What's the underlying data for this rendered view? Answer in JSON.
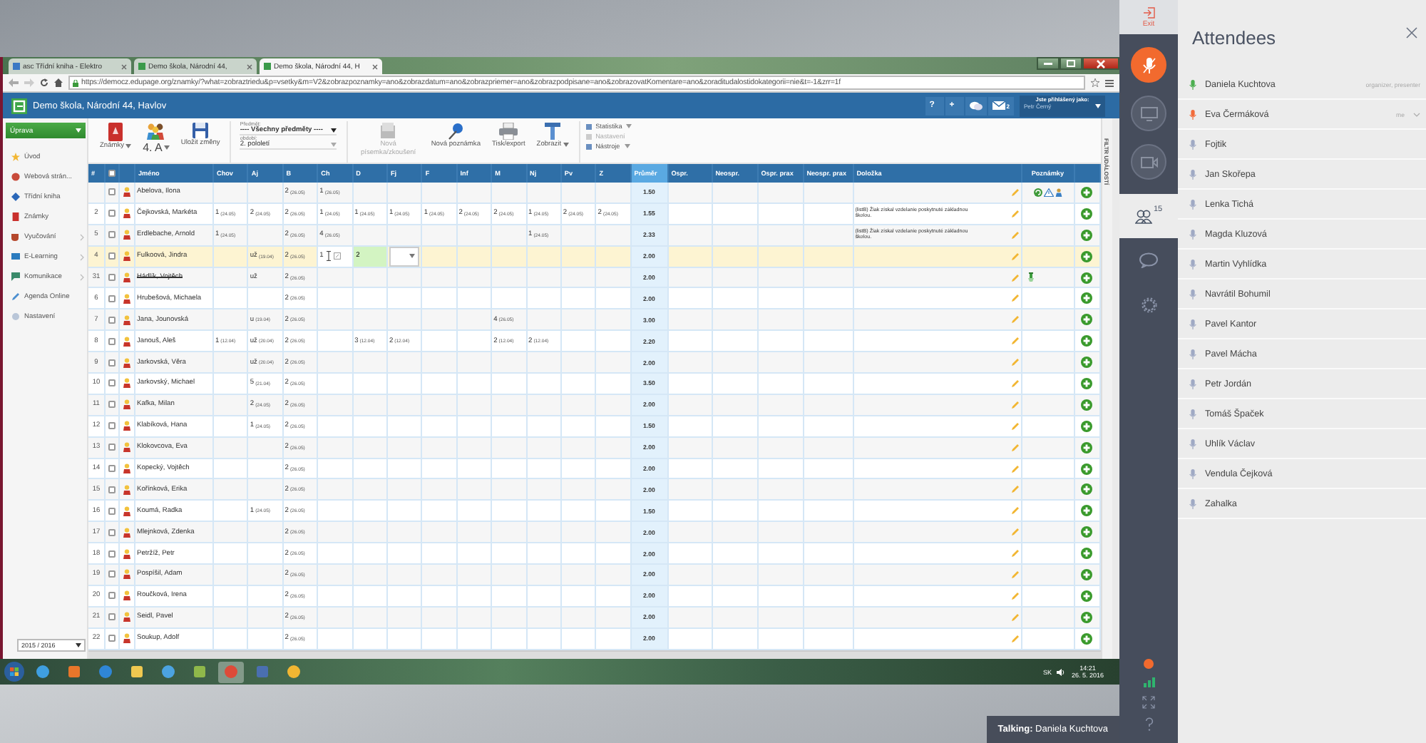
{
  "browser": {
    "tabs": [
      {
        "title": "asc Třídní kniha - Elektro",
        "selected": false
      },
      {
        "title": "Demo škola, Národní 44,",
        "selected": false
      },
      {
        "title": "Demo škola, Národní 44, H",
        "selected": true
      }
    ],
    "url": "https://democz.edupage.org/znamky/?what=zobraztriedu&p=vsetky&m=V2&zobrazpoznamky=ano&zobrazdatum=ano&zobrazpriemer=ano&zobrazpodpisane=ano&zobrazovatKomentare=ano&zoraditudalostidokategorii=nie&t=-1&zrr=1f"
  },
  "site": {
    "title": "Demo škola, Národní 44, Havlov",
    "header_buttons": [
      "?",
      "+"
    ],
    "mail_count": "2",
    "user_label": "Jste přihlášený jako:",
    "user_name": "Petr Černý"
  },
  "sidebar": {
    "action": "Úprava",
    "items": [
      {
        "label": "Úvod",
        "submenu": false
      },
      {
        "label": "Webová strán...",
        "submenu": false
      },
      {
        "label": "Třídní kniha",
        "submenu": false
      },
      {
        "label": "Známky",
        "submenu": false
      },
      {
        "label": "Vyučování",
        "submenu": true
      },
      {
        "label": "E-Learning",
        "submenu": true
      },
      {
        "label": "Komunikace",
        "submenu": true
      },
      {
        "label": "Agenda Online",
        "submenu": false
      },
      {
        "label": "Nastavení",
        "submenu": false
      }
    ],
    "year": "2015 / 2016"
  },
  "toolbar": {
    "buttons": [
      {
        "label": "Známky",
        "kind": "icon",
        "dropdown": true
      },
      {
        "label": "4. A",
        "kind": "class",
        "dropdown": true
      },
      {
        "label": "Uložit změny",
        "kind": "icon",
        "dropdown": false
      }
    ],
    "picker": {
      "label": "Předmět:",
      "value": "---- Všechny předměty ----",
      "period_label": "období:",
      "period_value": "2. pololetí"
    },
    "actions": [
      {
        "label": "Nová písemka/zkoušení",
        "disabled": true,
        "dropdown": false
      },
      {
        "label": "Nová poznámka",
        "disabled": false,
        "dropdown": false
      },
      {
        "label": "Tisk/export",
        "disabled": false,
        "dropdown": false
      },
      {
        "label": "Zobrazit",
        "disabled": false,
        "dropdown": true
      }
    ],
    "menu": [
      {
        "label": "Statistika",
        "disabled": false,
        "dropdown": true
      },
      {
        "label": "Nastavení",
        "disabled": true,
        "dropdown": false
      },
      {
        "label": "Nástroje",
        "disabled": false,
        "dropdown": true
      }
    ]
  },
  "table": {
    "number_header": "#",
    "all_checked": false,
    "name_header": "Jméno",
    "subjects": [
      "Chov",
      "Aj",
      "B",
      "Ch",
      "D",
      "Fj",
      "F",
      "Inf",
      "M",
      "Nj",
      "Pv",
      "Z"
    ],
    "average_header": "Průměr",
    "absence_headers": [
      "Ospr.",
      "Neospr.",
      "Ospr. prax",
      "Neospr. prax"
    ],
    "clause_header": "Doložka",
    "notes_header": "Poznámky",
    "rows": [
      {
        "name": "Abelova, Ilona",
        "checked": false,
        "selected": false,
        "withdrawn": false,
        "grades": [
          {
            "kind": "empty"
          },
          {
            "kind": "empty"
          },
          {
            "kind": "grade",
            "grade": "2",
            "date": "(26.05)"
          },
          {
            "kind": "grade",
            "grade": "1",
            "date": "(26.05)"
          },
          {
            "kind": "empty"
          },
          {
            "kind": "empty"
          },
          {
            "kind": "empty"
          },
          {
            "kind": "empty"
          },
          {
            "kind": "empty"
          },
          {
            "kind": "empty"
          },
          {
            "kind": "empty"
          },
          {
            "kind": "empty"
          }
        ],
        "average": "1.50",
        "note": {
          "kind": "alerts"
        }
      },
      {
        "number": "2",
        "name": "Čejkovská, Markéta",
        "checked": false,
        "selected": false,
        "withdrawn": false,
        "grades": [
          {
            "kind": "grade",
            "grade": "1",
            "date": "(24.05)"
          },
          {
            "kind": "grade",
            "grade": "2",
            "date": "(24.05)"
          },
          {
            "kind": "grade",
            "grade": "2",
            "date": "(26.05)"
          },
          {
            "kind": "grade",
            "grade": "1",
            "date": "(24.05)"
          },
          {
            "kind": "grade",
            "grade": "1",
            "date": "(24.05)"
          },
          {
            "kind": "grade",
            "grade": "1",
            "date": "(24.05)"
          },
          {
            "kind": "grade",
            "grade": "1",
            "date": "(24.05)"
          },
          {
            "kind": "grade",
            "grade": "2",
            "date": "(24.05)"
          },
          {
            "kind": "grade",
            "grade": "2",
            "date": "(24.05)"
          },
          {
            "kind": "grade",
            "grade": "1",
            "date": "(24.05)"
          },
          {
            "kind": "grade",
            "grade": "2",
            "date": "(24.05)"
          },
          {
            "kind": "grade",
            "grade": "2",
            "date": "(24.05)"
          }
        ],
        "average": "1.55",
        "clause": "(listB) Žiak získal vzdelanie poskytnuté základnou školou."
      },
      {
        "number": "5",
        "name": "Erdlebache, Arnold",
        "checked": false,
        "selected": false,
        "withdrawn": false,
        "grades": [
          {
            "kind": "grade",
            "grade": "1",
            "date": "(24.05)"
          },
          {
            "kind": "empty"
          },
          {
            "kind": "grade",
            "grade": "2",
            "date": "(26.05)"
          },
          {
            "kind": "grade",
            "grade": "4",
            "date": "(26.05)"
          },
          {
            "kind": "empty"
          },
          {
            "kind": "empty"
          },
          {
            "kind": "empty"
          },
          {
            "kind": "empty"
          },
          {
            "kind": "empty"
          },
          {
            "kind": "grade",
            "grade": "1",
            "date": "(24.05)"
          },
          {
            "kind": "empty"
          },
          {
            "kind": "empty"
          }
        ],
        "average": "2.33",
        "clause": "(listB) Žiak získal vzdelanie poskytnuté základnou školou."
      },
      {
        "number": "4",
        "name": "Fulkoová, Jindra",
        "checked": false,
        "selected": true,
        "withdrawn": false,
        "grades": [
          {
            "kind": "empty"
          },
          {
            "kind": "grade",
            "grade": "už",
            "date": "(19.04)"
          },
          {
            "kind": "grade",
            "grade": "2",
            "date": "(26.05)"
          },
          {
            "kind": "cursor",
            "grade": "1"
          },
          {
            "kind": "editing",
            "grade": "2"
          },
          {
            "kind": "select"
          },
          {
            "kind": "empty"
          },
          {
            "kind": "empty"
          },
          {
            "kind": "empty"
          },
          {
            "kind": "empty"
          },
          {
            "kind": "empty"
          },
          {
            "kind": "empty"
          }
        ],
        "average": "2.00"
      },
      {
        "number": "31",
        "name": "Hádlík, Vojtěch",
        "checked": false,
        "selected": false,
        "withdrawn": true,
        "grades": [
          {
            "kind": "empty"
          },
          {
            "kind": "grade",
            "grade": "už"
          },
          {
            "kind": "grade",
            "grade": "2",
            "date": "(26.05)"
          },
          {
            "kind": "empty"
          },
          {
            "kind": "empty"
          },
          {
            "kind": "empty"
          },
          {
            "kind": "empty"
          },
          {
            "kind": "empty"
          },
          {
            "kind": "empty"
          },
          {
            "kind": "empty"
          },
          {
            "kind": "empty"
          },
          {
            "kind": "empty"
          }
        ],
        "average": "2.00",
        "note": {
          "kind": "pin"
        }
      },
      {
        "number": "6",
        "name": "Hrubešová, Michaela",
        "checked": false,
        "selected": false,
        "withdrawn": false,
        "grades": [
          {
            "kind": "empty"
          },
          {
            "kind": "empty"
          },
          {
            "kind": "grade",
            "grade": "2",
            "date": "(26.05)"
          },
          {
            "kind": "empty"
          },
          {
            "kind": "empty"
          },
          {
            "kind": "empty"
          },
          {
            "kind": "empty"
          },
          {
            "kind": "empty"
          },
          {
            "kind": "empty"
          },
          {
            "kind": "empty"
          },
          {
            "kind": "empty"
          },
          {
            "kind": "empty"
          }
        ],
        "average": "2.00"
      },
      {
        "number": "7",
        "name": "Jana, Jounovská",
        "checked": false,
        "selected": false,
        "withdrawn": false,
        "grades": [
          {
            "kind": "empty"
          },
          {
            "kind": "grade",
            "grade": "u",
            "date": "(19.04)"
          },
          {
            "kind": "grade",
            "grade": "2",
            "date": "(26.05)"
          },
          {
            "kind": "empty"
          },
          {
            "kind": "empty"
          },
          {
            "kind": "empty"
          },
          {
            "kind": "empty"
          },
          {
            "kind": "empty"
          },
          {
            "kind": "grade",
            "grade": "4",
            "date": "(26.05)"
          },
          {
            "kind": "empty"
          },
          {
            "kind": "empty"
          },
          {
            "kind": "empty"
          }
        ],
        "average": "3.00"
      },
      {
        "number": "8",
        "name": "Janouš, Aleš",
        "checked": false,
        "selected": false,
        "withdrawn": false,
        "grades": [
          {
            "kind": "grade",
            "grade": "1",
            "date": "(12.04)"
          },
          {
            "kind": "grade",
            "grade": "už",
            "date": "(20.04)"
          },
          {
            "kind": "grade",
            "grade": "2",
            "date": "(26.05)"
          },
          {
            "kind": "empty"
          },
          {
            "kind": "grade",
            "grade": "3",
            "date": "(12.04)"
          },
          {
            "kind": "grade",
            "grade": "2",
            "date": "(12.04)"
          },
          {
            "kind": "empty"
          },
          {
            "kind": "empty"
          },
          {
            "kind": "grade",
            "grade": "2",
            "date": "(12.04)"
          },
          {
            "kind": "grade",
            "grade": "2",
            "date": "(12.04)"
          },
          {
            "kind": "empty"
          },
          {
            "kind": "empty"
          }
        ],
        "average": "2.20"
      },
      {
        "number": "9",
        "name": "Jarkovská, Věra",
        "checked": false,
        "selected": false,
        "withdrawn": false,
        "grades": [
          {
            "kind": "empty"
          },
          {
            "kind": "grade",
            "grade": "už",
            "date": "(20.04)"
          },
          {
            "kind": "grade",
            "grade": "2",
            "date": "(26.05)"
          },
          {
            "kind": "empty"
          },
          {
            "kind": "empty"
          },
          {
            "kind": "empty"
          },
          {
            "kind": "empty"
          },
          {
            "kind": "empty"
          },
          {
            "kind": "empty"
          },
          {
            "kind": "empty"
          },
          {
            "kind": "empty"
          },
          {
            "kind": "empty"
          }
        ],
        "average": "2.00"
      },
      {
        "number": "10",
        "name": "Jarkovský, Michael",
        "checked": false,
        "selected": false,
        "withdrawn": false,
        "grades": [
          {
            "kind": "empty"
          },
          {
            "kind": "grade",
            "grade": "5",
            "date": "(21.04)"
          },
          {
            "kind": "grade",
            "grade": "2",
            "date": "(26.05)"
          },
          {
            "kind": "empty"
          },
          {
            "kind": "empty"
          },
          {
            "kind": "empty"
          },
          {
            "kind": "empty"
          },
          {
            "kind": "empty"
          },
          {
            "kind": "empty"
          },
          {
            "kind": "empty"
          },
          {
            "kind": "empty"
          },
          {
            "kind": "empty"
          }
        ],
        "average": "3.50"
      },
      {
        "number": "11",
        "name": "Kafka, Milan",
        "checked": false,
        "selected": false,
        "withdrawn": false,
        "grades": [
          {
            "kind": "empty"
          },
          {
            "kind": "grade",
            "grade": "2",
            "date": "(24.05)"
          },
          {
            "kind": "grade",
            "grade": "2",
            "date": "(26.05)"
          },
          {
            "kind": "empty"
          },
          {
            "kind": "empty"
          },
          {
            "kind": "empty"
          },
          {
            "kind": "empty"
          },
          {
            "kind": "empty"
          },
          {
            "kind": "empty"
          },
          {
            "kind": "empty"
          },
          {
            "kind": "empty"
          },
          {
            "kind": "empty"
          }
        ],
        "average": "2.00"
      },
      {
        "number": "12",
        "name": "Klabíková, Hana",
        "checked": false,
        "selected": false,
        "withdrawn": false,
        "grades": [
          {
            "kind": "empty"
          },
          {
            "kind": "grade",
            "grade": "1",
            "date": "(24.05)"
          },
          {
            "kind": "grade",
            "grade": "2",
            "date": "(26.05)"
          },
          {
            "kind": "empty"
          },
          {
            "kind": "empty"
          },
          {
            "kind": "empty"
          },
          {
            "kind": "empty"
          },
          {
            "kind": "empty"
          },
          {
            "kind": "empty"
          },
          {
            "kind": "empty"
          },
          {
            "kind": "empty"
          },
          {
            "kind": "empty"
          }
        ],
        "average": "1.50"
      },
      {
        "number": "13",
        "name": "Klokovcova, Eva",
        "checked": false,
        "selected": false,
        "withdrawn": false,
        "grades": [
          {
            "kind": "empty"
          },
          {
            "kind": "empty"
          },
          {
            "kind": "grade",
            "grade": "2",
            "date": "(26.05)"
          },
          {
            "kind": "empty"
          },
          {
            "kind": "empty"
          },
          {
            "kind": "empty"
          },
          {
            "kind": "empty"
          },
          {
            "kind": "empty"
          },
          {
            "kind": "empty"
          },
          {
            "kind": "empty"
          },
          {
            "kind": "empty"
          },
          {
            "kind": "empty"
          }
        ],
        "average": "2.00"
      },
      {
        "number": "14",
        "name": "Kopecký, Vojtěch",
        "checked": false,
        "selected": false,
        "withdrawn": false,
        "grades": [
          {
            "kind": "empty"
          },
          {
            "kind": "empty"
          },
          {
            "kind": "grade",
            "grade": "2",
            "date": "(26.05)"
          },
          {
            "kind": "empty"
          },
          {
            "kind": "empty"
          },
          {
            "kind": "empty"
          },
          {
            "kind": "empty"
          },
          {
            "kind": "empty"
          },
          {
            "kind": "empty"
          },
          {
            "kind": "empty"
          },
          {
            "kind": "empty"
          },
          {
            "kind": "empty"
          }
        ],
        "average": "2.00"
      },
      {
        "number": "15",
        "name": "Kořínková, Erika",
        "checked": false,
        "selected": false,
        "withdrawn": false,
        "grades": [
          {
            "kind": "empty"
          },
          {
            "kind": "empty"
          },
          {
            "kind": "grade",
            "grade": "2",
            "date": "(26.05)"
          },
          {
            "kind": "empty"
          },
          {
            "kind": "empty"
          },
          {
            "kind": "empty"
          },
          {
            "kind": "empty"
          },
          {
            "kind": "empty"
          },
          {
            "kind": "empty"
          },
          {
            "kind": "empty"
          },
          {
            "kind": "empty"
          },
          {
            "kind": "empty"
          }
        ],
        "average": "2.00"
      },
      {
        "number": "16",
        "name": "Koumá, Radka",
        "checked": false,
        "selected": false,
        "withdrawn": false,
        "grades": [
          {
            "kind": "empty"
          },
          {
            "kind": "grade",
            "grade": "1",
            "date": "(24.05)"
          },
          {
            "kind": "grade",
            "grade": "2",
            "date": "(26.05)"
          },
          {
            "kind": "empty"
          },
          {
            "kind": "empty"
          },
          {
            "kind": "empty"
          },
          {
            "kind": "empty"
          },
          {
            "kind": "empty"
          },
          {
            "kind": "empty"
          },
          {
            "kind": "empty"
          },
          {
            "kind": "empty"
          },
          {
            "kind": "empty"
          }
        ],
        "average": "1.50"
      },
      {
        "number": "17",
        "name": "Mlejnková, Zdenka",
        "checked": false,
        "selected": false,
        "withdrawn": false,
        "grades": [
          {
            "kind": "empty"
          },
          {
            "kind": "empty"
          },
          {
            "kind": "grade",
            "grade": "2",
            "date": "(26.05)"
          },
          {
            "kind": "empty"
          },
          {
            "kind": "empty"
          },
          {
            "kind": "empty"
          },
          {
            "kind": "empty"
          },
          {
            "kind": "empty"
          },
          {
            "kind": "empty"
          },
          {
            "kind": "empty"
          },
          {
            "kind": "empty"
          },
          {
            "kind": "empty"
          }
        ],
        "average": "2.00"
      },
      {
        "number": "18",
        "name": "Petržíž, Petr",
        "checked": false,
        "selected": false,
        "withdrawn": false,
        "grades": [
          {
            "kind": "empty"
          },
          {
            "kind": "empty"
          },
          {
            "kind": "grade",
            "grade": "2",
            "date": "(26.05)"
          },
          {
            "kind": "empty"
          },
          {
            "kind": "empty"
          },
          {
            "kind": "empty"
          },
          {
            "kind": "empty"
          },
          {
            "kind": "empty"
          },
          {
            "kind": "empty"
          },
          {
            "kind": "empty"
          },
          {
            "kind": "empty"
          },
          {
            "kind": "empty"
          }
        ],
        "average": "2.00"
      },
      {
        "number": "19",
        "name": "Pospíšil, Adam",
        "checked": false,
        "selected": false,
        "withdrawn": false,
        "grades": [
          {
            "kind": "empty"
          },
          {
            "kind": "empty"
          },
          {
            "kind": "grade",
            "grade": "2",
            "date": "(26.05)"
          },
          {
            "kind": "empty"
          },
          {
            "kind": "empty"
          },
          {
            "kind": "empty"
          },
          {
            "kind": "empty"
          },
          {
            "kind": "empty"
          },
          {
            "kind": "empty"
          },
          {
            "kind": "empty"
          },
          {
            "kind": "empty"
          },
          {
            "kind": "empty"
          }
        ],
        "average": "2.00"
      },
      {
        "number": "20",
        "name": "Roučková, Irena",
        "checked": false,
        "selected": false,
        "withdrawn": false,
        "grades": [
          {
            "kind": "empty"
          },
          {
            "kind": "empty"
          },
          {
            "kind": "grade",
            "grade": "2",
            "date": "(26.05)"
          },
          {
            "kind": "empty"
          },
          {
            "kind": "empty"
          },
          {
            "kind": "empty"
          },
          {
            "kind": "empty"
          },
          {
            "kind": "empty"
          },
          {
            "kind": "empty"
          },
          {
            "kind": "empty"
          },
          {
            "kind": "empty"
          },
          {
            "kind": "empty"
          }
        ],
        "average": "2.00"
      },
      {
        "number": "21",
        "name": "Seidl, Pavel",
        "checked": false,
        "selected": false,
        "withdrawn": false,
        "grades": [
          {
            "kind": "empty"
          },
          {
            "kind": "empty"
          },
          {
            "kind": "grade",
            "grade": "2",
            "date": "(26.05)"
          },
          {
            "kind": "empty"
          },
          {
            "kind": "empty"
          },
          {
            "kind": "empty"
          },
          {
            "kind": "empty"
          },
          {
            "kind": "empty"
          },
          {
            "kind": "empty"
          },
          {
            "kind": "empty"
          },
          {
            "kind": "empty"
          },
          {
            "kind": "empty"
          }
        ],
        "average": "2.00"
      },
      {
        "number": "22",
        "name": "Soukup, Adolf",
        "checked": false,
        "selected": false,
        "withdrawn": false,
        "grades": [
          {
            "kind": "empty"
          },
          {
            "kind": "empty"
          },
          {
            "kind": "grade",
            "grade": "2",
            "date": "(26.05)"
          },
          {
            "kind": "empty"
          },
          {
            "kind": "empty"
          },
          {
            "kind": "empty"
          },
          {
            "kind": "empty"
          },
          {
            "kind": "empty"
          },
          {
            "kind": "empty"
          },
          {
            "kind": "empty"
          },
          {
            "kind": "empty"
          },
          {
            "kind": "empty"
          }
        ],
        "average": "2.00"
      }
    ]
  },
  "filter_label": "FILTR UDÁLOSTÍ",
  "taskbar": {
    "language": "SK",
    "time": "14:21",
    "date": "26. 5. 2016"
  },
  "talking": "**Talking:** Daniela Kuchtova",
  "rail": {
    "exit": "Exit",
    "media": [
      {
        "kind": "microphone",
        "active": true
      },
      {
        "kind": "screen",
        "active": false
      },
      {
        "kind": "camera",
        "active": false
      }
    ],
    "tabs": [
      {
        "kind": "attendees",
        "badge": "15",
        "selected": true
      },
      {
        "kind": "chat",
        "selected": false
      },
      {
        "kind": "settings",
        "selected": false
      }
    ]
  },
  "attendees": {
    "title": "Attendees",
    "items": [
      {
        "name": "Daniela Kuchtova",
        "role": "organizer, presenter",
        "color": "#4caf50",
        "menu": false
      },
      {
        "name": "Eva Čermáková",
        "role": "me",
        "color": "#f26b3a",
        "menu": true
      },
      {
        "name": "Fojtik",
        "color": "#9fa9c4",
        "menu": false
      },
      {
        "name": "Jan Skořepa",
        "color": "#9fa9c4",
        "menu": false
      },
      {
        "name": "Lenka Tichá",
        "color": "#9fa9c4",
        "menu": false
      },
      {
        "name": "Magda Kluzová",
        "color": "#9fa9c4",
        "menu": false
      },
      {
        "name": "Martin Vyhlídka",
        "color": "#9fa9c4",
        "menu": false
      },
      {
        "name": "Navrátil Bohumil",
        "color": "#9fa9c4",
        "menu": false
      },
      {
        "name": "Pavel Kantor",
        "color": "#9fa9c4",
        "menu": false
      },
      {
        "name": "Pavel Mácha",
        "color": "#9fa9c4",
        "menu": false
      },
      {
        "name": "Petr Jordán",
        "color": "#9fa9c4",
        "menu": false
      },
      {
        "name": "Tomáš Špaček",
        "color": "#9fa9c4",
        "menu": false
      },
      {
        "name": "Uhlík Václav",
        "color": "#9fa9c4",
        "menu": false
      },
      {
        "name": "Vendula Čejková",
        "color": "#9fa9c4",
        "menu": false
      },
      {
        "name": "Zahalka",
        "color": "#9fa9c4",
        "menu": false
      }
    ]
  }
}
